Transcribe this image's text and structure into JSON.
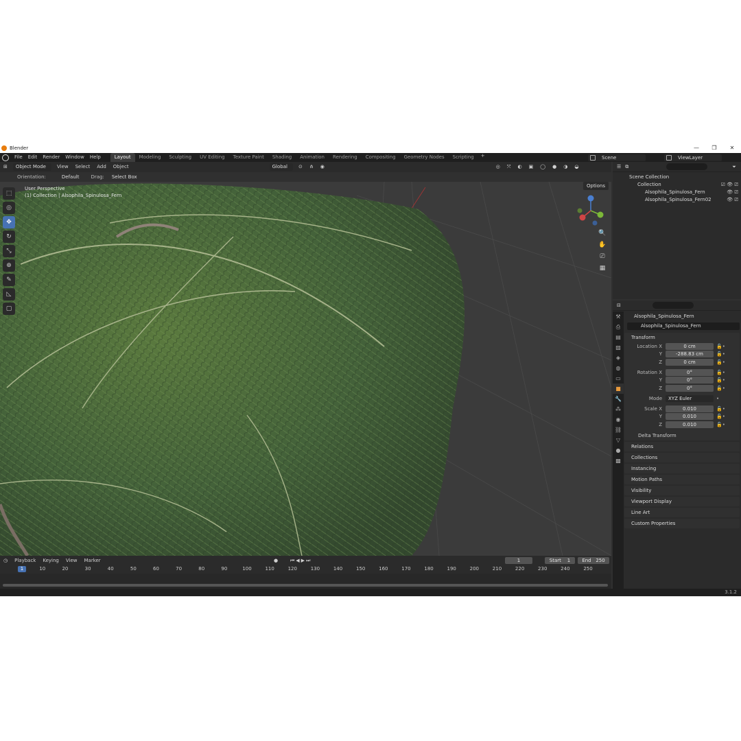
{
  "window": {
    "title": "Blender"
  },
  "menubar": {
    "menus": [
      "File",
      "Edit",
      "Render",
      "Window",
      "Help"
    ],
    "workspaces": [
      "Layout",
      "Modeling",
      "Sculpting",
      "UV Editing",
      "Texture Paint",
      "Shading",
      "Animation",
      "Rendering",
      "Compositing",
      "Geometry Nodes",
      "Scripting"
    ],
    "active_workspace": "Layout",
    "scene": "Scene",
    "view_layer": "ViewLayer"
  },
  "viewport_header": {
    "mode": "Object Mode",
    "menus": [
      "View",
      "Select",
      "Add",
      "Object"
    ],
    "transform": "Global",
    "orientation_label": "Orientation:",
    "orientation": "Default",
    "drag_label": "Drag:",
    "drag": "Select Box",
    "options": "Options"
  },
  "viewport": {
    "perspective": "User Perspective",
    "collection_info": "(1) Collection | Alsophila_Spinulosa_Fern"
  },
  "timeline": {
    "menus": [
      "Playback",
      "Keying",
      "View",
      "Marker"
    ],
    "current_frame": "1",
    "start_label": "Start",
    "start": "1",
    "end_label": "End",
    "end": "250",
    "ticks": [
      "1",
      "10",
      "20",
      "30",
      "40",
      "50",
      "60",
      "70",
      "80",
      "90",
      "100",
      "110",
      "120",
      "130",
      "140",
      "150",
      "160",
      "170",
      "180",
      "190",
      "200",
      "210",
      "220",
      "230",
      "240",
      "250"
    ]
  },
  "outliner": {
    "scene_collection": "Scene Collection",
    "collection": "Collection",
    "objects": [
      "Alsophila_Spinulosa_Fern",
      "Alsophila_Spinulosa_Fern02"
    ]
  },
  "properties": {
    "object_name": "Alsophila_Spinulosa_Fern",
    "object_field": "Alsophila_Spinulosa_Fern",
    "transform": {
      "title": "Transform",
      "location_label": "Location X",
      "loc_x": "0 cm",
      "loc_y": "-288.83 cm",
      "loc_z": "0 cm",
      "rotation_label": "Rotation X",
      "rot_x": "0°",
      "rot_y": "0°",
      "rot_z": "0°",
      "mode_label": "Mode",
      "mode": "XYZ Euler",
      "scale_label": "Scale X",
      "scale_x": "0.010",
      "scale_y": "0.010",
      "scale_z": "0.010",
      "y_label": "Y",
      "z_label": "Z",
      "delta": "Delta Transform"
    },
    "panels": [
      "Relations",
      "Collections",
      "Instancing",
      "Motion Paths",
      "Visibility",
      "Viewport Display",
      "Line Art",
      "Custom Properties"
    ]
  },
  "status": {
    "version": "3.1.2"
  }
}
